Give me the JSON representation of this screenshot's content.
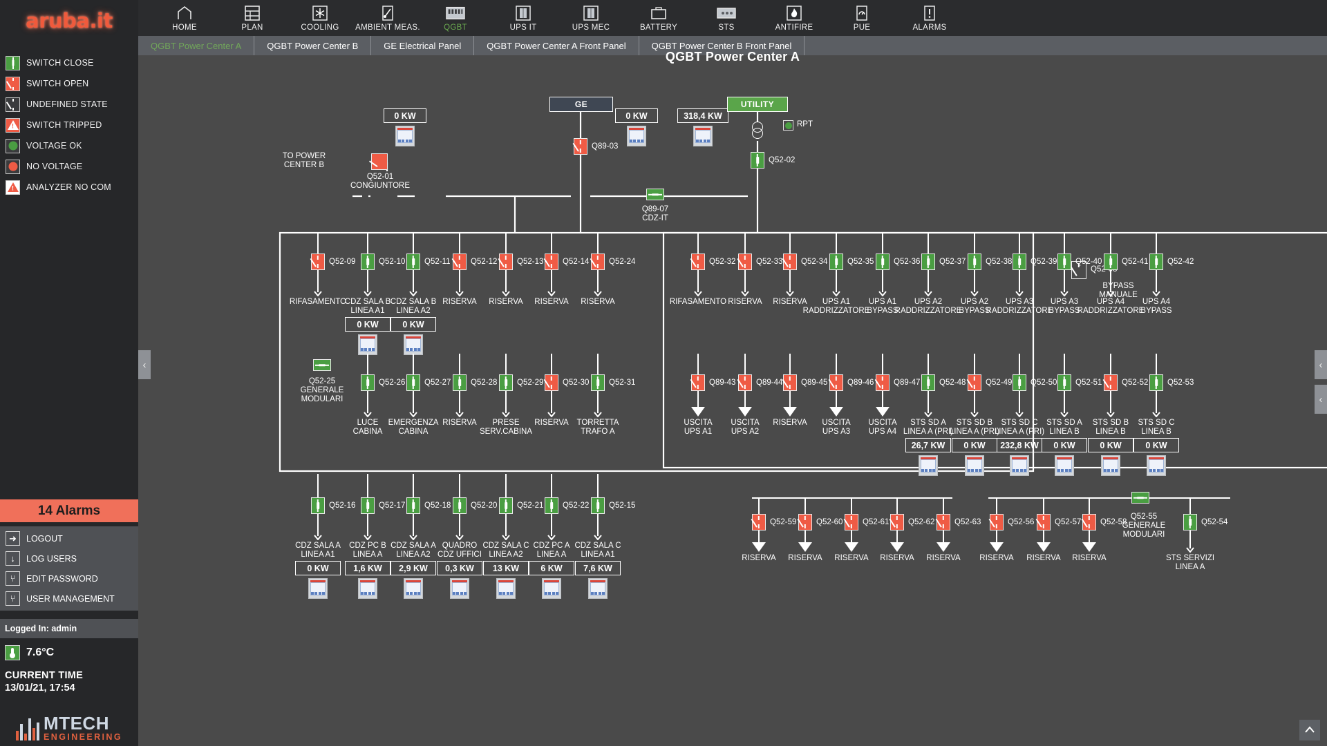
{
  "brand": {
    "logo_text": "aruba.it"
  },
  "legend": {
    "items": [
      {
        "label": "SWITCH CLOSE",
        "sym": "breaker-closed-green"
      },
      {
        "label": "SWITCH OPEN",
        "sym": "breaker-open-red"
      },
      {
        "label": "UNDEFINED STATE",
        "sym": "breaker-open-dark"
      },
      {
        "label": "SWITCH TRIPPED",
        "sym": "breaker-tripped-red"
      },
      {
        "label": "VOLTAGE OK",
        "sym": "dot-green"
      },
      {
        "label": "NO VOLTAGE",
        "sym": "dot-red"
      },
      {
        "label": "ANALYZER NO COM",
        "sym": "analyzer-nocom"
      }
    ]
  },
  "alarms": {
    "text": "14 Alarms",
    "count": 14
  },
  "user_menu": {
    "items": [
      {
        "label": "LOGOUT",
        "icon": "arrow-right-icon"
      },
      {
        "label": "LOG USERS",
        "icon": "arrow-down-icon"
      },
      {
        "label": "EDIT PASSWORD",
        "icon": "wrench-icon"
      },
      {
        "label": "USER MANAGEMENT",
        "icon": "wrench-icon"
      }
    ]
  },
  "status": {
    "logged_in": "Logged In: admin",
    "temperature": "7.6°C",
    "time_title": "CURRENT TIME",
    "time_value": "13/01/21, 17:54"
  },
  "vendor": {
    "main": "MTECH",
    "sub": "ENGINEERING"
  },
  "topnav": {
    "items": [
      {
        "label": "HOME",
        "icon": "home-icon",
        "active": false
      },
      {
        "label": "PLAN",
        "icon": "plan-icon",
        "active": false
      },
      {
        "label": "COOLING",
        "icon": "snowflake-icon",
        "active": false
      },
      {
        "label": "AMBIENT MEAS.",
        "icon": "probe-icon",
        "active": false
      },
      {
        "label": "QGBT",
        "icon": "switchboard-icon",
        "active": true
      },
      {
        "label": "UPS IT",
        "icon": "ups-icon",
        "active": false
      },
      {
        "label": "UPS MEC",
        "icon": "ups-icon",
        "active": false
      },
      {
        "label": "BATTERY",
        "icon": "battery-icon",
        "active": false
      },
      {
        "label": "STS",
        "icon": "sts-icon",
        "active": false
      },
      {
        "label": "ANTIFIRE",
        "icon": "flame-icon",
        "active": false
      },
      {
        "label": "PUE",
        "icon": "gauge-icon",
        "active": false
      },
      {
        "label": "ALARMS",
        "icon": "alert-icon",
        "active": false
      }
    ]
  },
  "tabs": [
    {
      "label": "QGBT Power Center A",
      "active": true
    },
    {
      "label": "QGBT Power Center B",
      "active": false
    },
    {
      "label": "GE Electrical Panel",
      "active": false
    },
    {
      "label": "QGBT Power Center A Front Panel",
      "active": false
    },
    {
      "label": "QGBT Power Center B Front Panel",
      "active": false
    }
  ],
  "page": {
    "title": "QGBT Power Center A"
  },
  "sources": {
    "ge": {
      "label": "GE",
      "kw": "0 KW"
    },
    "utility": {
      "label": "UTILITY",
      "kw": "318,4 KW"
    },
    "rpt": {
      "label": "RPT",
      "state": "green"
    },
    "left_feed_kw": "0 KW",
    "to_power_center_b": "TO POWER\nCENTER B",
    "to_power_center_b_l1": "TO POWER",
    "to_power_center_b_l2": "CENTER B"
  },
  "tie_breakers": {
    "q89_03": "Q89-03",
    "q52_02": "Q52-02",
    "q52_01": {
      "id": "Q52-01",
      "name": "CONGIUNTORE"
    },
    "q89_07": {
      "id": "Q89-07",
      "name": "CDZ-IT"
    },
    "q52_08": {
      "id": "Q52-08",
      "name_l1": "BYPASS",
      "name_l2": "MANUALE"
    }
  },
  "row_left_top": {
    "items": [
      {
        "id": "Q52-09",
        "state": "open",
        "name_l1": "RIFASAMENTO",
        "name_l2": "",
        "kw": null
      },
      {
        "id": "Q52-10",
        "state": "closed",
        "name_l1": "CDZ SALA B",
        "name_l2": "LINEA A1",
        "kw": "0 KW"
      },
      {
        "id": "Q52-11",
        "state": "closed",
        "name_l1": "CDZ SALA B",
        "name_l2": "LINEA A2",
        "kw": "0 KW"
      },
      {
        "id": "Q52-12",
        "state": "open",
        "name_l1": "RISERVA",
        "name_l2": "",
        "kw": null
      },
      {
        "id": "Q52-13",
        "state": "open",
        "name_l1": "RISERVA",
        "name_l2": "",
        "kw": null
      },
      {
        "id": "Q52-14",
        "state": "open",
        "name_l1": "RISERVA",
        "name_l2": "",
        "kw": null
      },
      {
        "id": "Q52-24",
        "state": "open",
        "name_l1": "RISERVA",
        "name_l2": "",
        "kw": null
      }
    ]
  },
  "row_right_top": {
    "items": [
      {
        "id": "Q52-32",
        "state": "open",
        "name_l1": "RIFASAMENTO",
        "name_l2": ""
      },
      {
        "id": "Q52-33",
        "state": "open",
        "name_l1": "RISERVA",
        "name_l2": ""
      },
      {
        "id": "Q52-34",
        "state": "open",
        "name_l1": "RISERVA",
        "name_l2": ""
      },
      {
        "id": "Q52-35",
        "state": "closed",
        "name_l1": "UPS A1",
        "name_l2": "RADDRIZZATORE"
      },
      {
        "id": "Q52-36",
        "state": "closed",
        "name_l1": "UPS A1",
        "name_l2": "BYPASS"
      },
      {
        "id": "Q52-37",
        "state": "closed",
        "name_l1": "UPS A2",
        "name_l2": "RADDRIZZATORE"
      },
      {
        "id": "Q52-38",
        "state": "closed",
        "name_l1": "UPS A2",
        "name_l2": "BYPASS"
      },
      {
        "id": "Q52-39",
        "state": "closed",
        "name_l1": "UPS A3",
        "name_l2": "RADDRIZZATORE"
      },
      {
        "id": "Q52-40",
        "state": "closed",
        "name_l1": "UPS A3",
        "name_l2": "BYPASS"
      },
      {
        "id": "Q52-41",
        "state": "closed",
        "name_l1": "UPS A4",
        "name_l2": "RADDRIZZATORE"
      },
      {
        "id": "Q52-42",
        "state": "closed",
        "name_l1": "UPS A4",
        "name_l2": "BYPASS"
      }
    ]
  },
  "row_left_mid": {
    "generale": {
      "id": "Q52-25",
      "state": "closed-h",
      "name_l1": "GENERALE",
      "name_l2": "MODULARI"
    },
    "items": [
      {
        "id": "Q52-26",
        "state": "closed",
        "name_l1": "LUCE",
        "name_l2": "CABINA"
      },
      {
        "id": "Q52-27",
        "state": "closed",
        "name_l1": "EMERGENZA",
        "name_l2": "CABINA"
      },
      {
        "id": "Q52-28",
        "state": "closed",
        "name_l1": "RISERVA",
        "name_l2": ""
      },
      {
        "id": "Q52-29",
        "state": "closed",
        "name_l1": "PRESE",
        "name_l2": "SERV.CABINA"
      },
      {
        "id": "Q52-30",
        "state": "open",
        "name_l1": "RISERVA",
        "name_l2": ""
      },
      {
        "id": "Q52-31",
        "state": "closed",
        "name_l1": "TORRETTA",
        "name_l2": "TRAFO A"
      }
    ]
  },
  "row_right_mid": {
    "items": [
      {
        "id": "Q89-43",
        "state": "open",
        "name_l1": "USCITA",
        "name_l2": "UPS A1",
        "term": "triangle",
        "kw": null
      },
      {
        "id": "Q89-44",
        "state": "open",
        "name_l1": "USCITA",
        "name_l2": "UPS A2",
        "term": "triangle",
        "kw": null
      },
      {
        "id": "Q89-45",
        "state": "open",
        "name_l1": "RISERVA",
        "name_l2": "",
        "term": "triangle",
        "kw": null
      },
      {
        "id": "Q89-46",
        "state": "open",
        "name_l1": "USCITA",
        "name_l2": "UPS A3",
        "term": "triangle",
        "kw": null
      },
      {
        "id": "Q89-47",
        "state": "open",
        "name_l1": "USCITA",
        "name_l2": "UPS A4",
        "term": "triangle",
        "kw": null
      },
      {
        "id": "Q52-48",
        "state": "closed",
        "name_l1": "STS SD A",
        "name_l2": "LINEA A (PRI)",
        "term": "arrow",
        "kw": "26,7 KW"
      },
      {
        "id": "Q52-49",
        "state": "open",
        "name_l1": "STS SD B",
        "name_l2": "LINEA A (PRI)",
        "term": "arrow",
        "kw": "0 KW"
      },
      {
        "id": "Q52-50",
        "state": "closed",
        "name_l1": "STS SD C",
        "name_l2": "LINEA A (PRI)",
        "term": "arrow",
        "kw": "232,8 KW"
      },
      {
        "id": "Q52-51",
        "state": "closed",
        "name_l1": "STS SD A",
        "name_l2": "LINEA B",
        "term": "arrow",
        "kw": "0 KW"
      },
      {
        "id": "Q52-52",
        "state": "open",
        "name_l1": "STS SD B",
        "name_l2": "LINEA B",
        "term": "arrow",
        "kw": "0 KW"
      },
      {
        "id": "Q52-53",
        "state": "closed",
        "name_l1": "STS SD C",
        "name_l2": "LINEA B",
        "term": "arrow",
        "kw": "0 KW"
      }
    ]
  },
  "row_left_bottom": {
    "items": [
      {
        "id": "Q52-16",
        "state": "closed",
        "name_l1": "CDZ SALA A",
        "name_l2": "LINEA A1",
        "kw": "0 KW"
      },
      {
        "id": "Q52-17",
        "state": "closed",
        "name_l1": "CDZ PC B",
        "name_l2": "LINEA A",
        "kw": "1,6 KW"
      },
      {
        "id": "Q52-18",
        "state": "closed",
        "name_l1": "CDZ SALA A",
        "name_l2": "LINEA A2",
        "kw": "2,9 KW"
      },
      {
        "id": "Q52-20",
        "state": "closed",
        "name_l1": "QUADRO",
        "name_l2": "CDZ UFFICI",
        "kw": "0,3 KW"
      },
      {
        "id": "Q52-21",
        "state": "closed",
        "name_l1": "CDZ SALA C",
        "name_l2": "LINEA A2",
        "kw": "13 KW"
      },
      {
        "id": "Q52-22",
        "state": "closed",
        "name_l1": "CDZ PC A",
        "name_l2": "LINEA A",
        "kw": "6 KW"
      },
      {
        "id": "Q52-15",
        "state": "closed",
        "name_l1": "CDZ SALA C",
        "name_l2": "LINEA A1",
        "kw": "7,6 KW"
      }
    ]
  },
  "row_right_bottom": {
    "items": [
      {
        "id": "Q52-59",
        "state": "open",
        "name_l1": "RISERVA",
        "name_l2": "",
        "term": "triangle"
      },
      {
        "id": "Q52-60",
        "state": "open",
        "name_l1": "RISERVA",
        "name_l2": "",
        "term": "triangle"
      },
      {
        "id": "Q52-61",
        "state": "open",
        "name_l1": "RISERVA",
        "name_l2": "",
        "term": "triangle"
      },
      {
        "id": "Q52-62",
        "state": "open",
        "name_l1": "RISERVA",
        "name_l2": "",
        "term": "triangle"
      },
      {
        "id": "Q52-63",
        "state": "open",
        "name_l1": "RISERVA",
        "name_l2": "",
        "term": "triangle"
      }
    ],
    "far": [
      {
        "id": "Q52-56",
        "state": "open",
        "name_l1": "RISERVA",
        "name_l2": "",
        "term": "triangle"
      },
      {
        "id": "Q52-57",
        "state": "open",
        "name_l1": "RISERVA",
        "name_l2": "",
        "term": "triangle"
      },
      {
        "id": "Q52-58",
        "state": "open",
        "name_l1": "RISERVA",
        "name_l2": "",
        "term": "triangle"
      }
    ],
    "generale": {
      "id": "Q52-55",
      "state": "closed-h",
      "name_l1": "GENERALE",
      "name_l2": "MODULARI"
    },
    "sts_servizi": {
      "id": "Q52-54",
      "state": "closed",
      "name_l1": "STS SERVIZI",
      "name_l2": "LINEA A"
    }
  },
  "colors": {
    "green": "#4a9e42",
    "red": "#ef5b45",
    "alarm": "#f0705a",
    "sidebar": "#262729",
    "canvas": "#4a4a4a"
  },
  "controls": {
    "collapse_left": "‹",
    "collapse_right_1": "‹",
    "collapse_right_2": "‹",
    "scroll_top": "⌃"
  }
}
